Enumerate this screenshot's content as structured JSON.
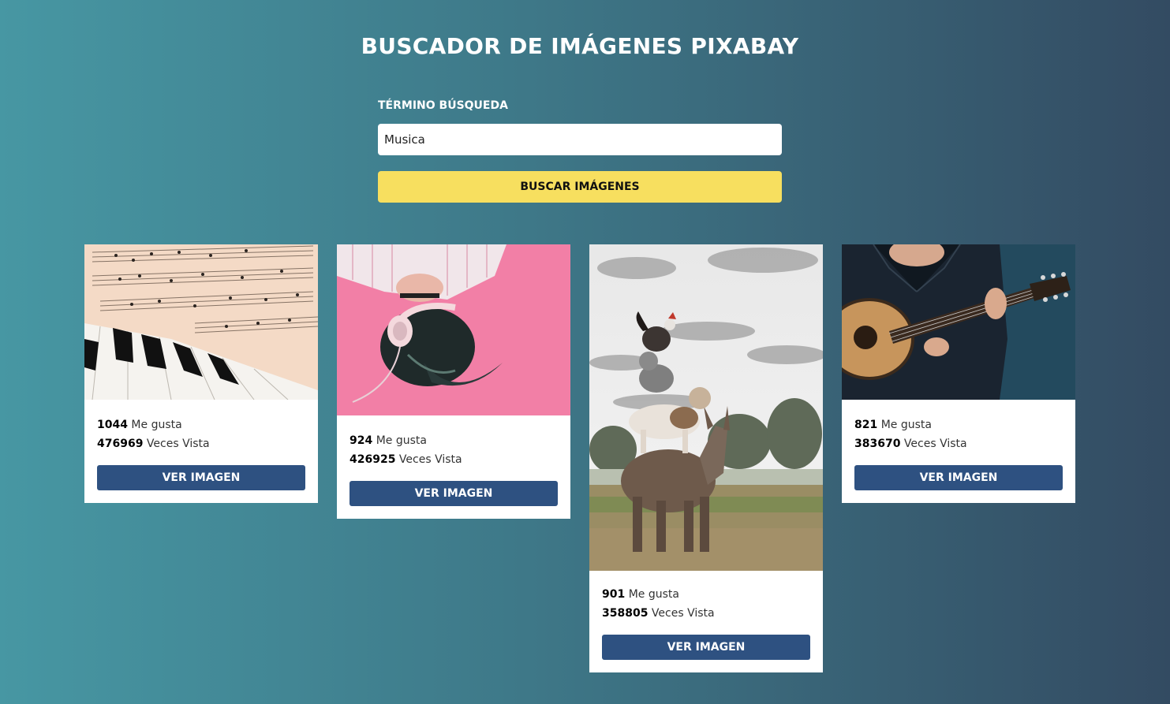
{
  "header": {
    "title": "BUSCADOR DE IMÁGENES PIXABAY"
  },
  "search": {
    "label": "TÉRMINO BÚSQUEDA",
    "value": "Musica",
    "button_label": "BUSCAR IMÁGENES"
  },
  "results": [
    {
      "likes": "1044",
      "likes_label": "Me gusta",
      "views": "476969",
      "views_label": "Veces Vista",
      "button_label": "VER IMAGEN",
      "image": "piano-sheet-music-image"
    },
    {
      "likes": "924",
      "likes_label": "Me gusta",
      "views": "426925",
      "views_label": "Veces Vista",
      "button_label": "VER IMAGEN",
      "image": "woman-headphones-image"
    },
    {
      "likes": "901",
      "likes_label": "Me gusta",
      "views": "358805",
      "views_label": "Veces Vista",
      "button_label": "VER IMAGEN",
      "image": "bremen-town-musicians-image"
    },
    {
      "likes": "821",
      "likes_label": "Me gusta",
      "views": "383670",
      "views_label": "Veces Vista",
      "button_label": "VER IMAGEN",
      "image": "guitar-player-image"
    }
  ],
  "colors": {
    "accent_button": "#f7df5f",
    "view_button": "#2e5181",
    "background_start": "#4797a3",
    "background_end": "#334b62"
  }
}
